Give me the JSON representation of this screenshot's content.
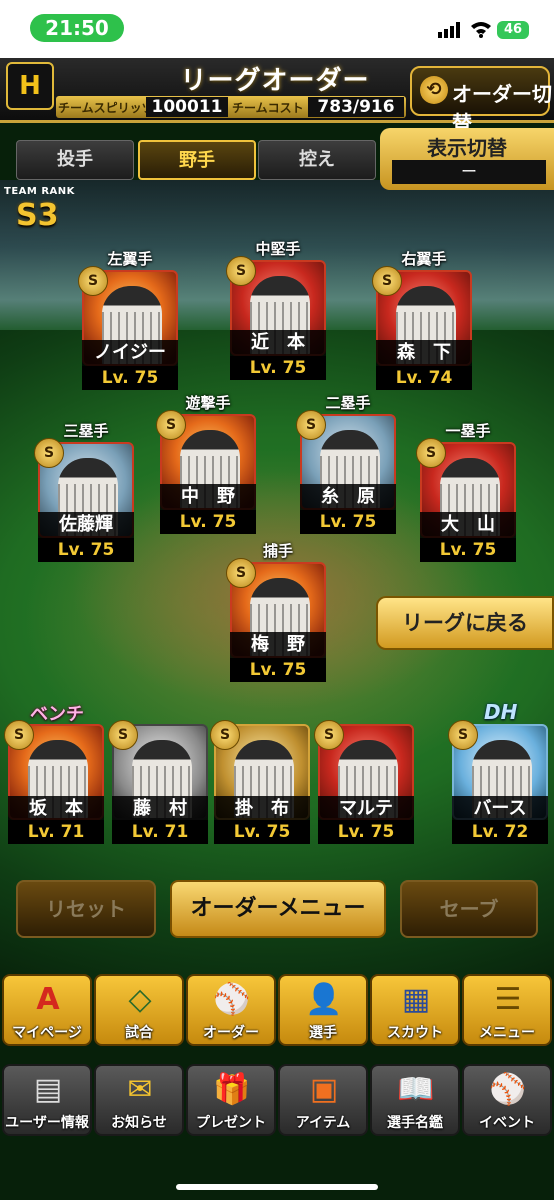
{
  "status_bar": {
    "time": "21:50",
    "battery": "46"
  },
  "header": {
    "logo": "H",
    "title": "リーグオーダー",
    "spirit_label": "チームスピリッツ",
    "spirit_value": "100011",
    "cost_label": "チームコスト",
    "cost_value": "783/916",
    "switch_button": "オーダー切替"
  },
  "tabs": [
    {
      "label": "投手",
      "active": false
    },
    {
      "label": "野手",
      "active": true
    },
    {
      "label": "控え",
      "active": false
    }
  ],
  "view_switch": {
    "label": "表示切替",
    "value": "ー"
  },
  "team_rank": {
    "label": "TEAM RANK",
    "value": "S3"
  },
  "players": [
    {
      "position": "左翼手",
      "name": "ノイジー",
      "level": "Lv. 75"
    },
    {
      "position": "中堅手",
      "name": "近　本",
      "level": "Lv. 75"
    },
    {
      "position": "右翼手",
      "name": "森　下",
      "level": "Lv. 74"
    },
    {
      "position": "遊撃手",
      "name": "中　野",
      "level": "Lv. 75"
    },
    {
      "position": "二塁手",
      "name": "糸　原",
      "level": "Lv. 75"
    },
    {
      "position": "三塁手",
      "name": "佐藤輝",
      "level": "Lv. 75"
    },
    {
      "position": "一塁手",
      "name": "大　山",
      "level": "Lv. 75"
    },
    {
      "position": "捕手",
      "name": "梅　野",
      "level": "Lv. 75"
    }
  ],
  "bench_label": "ベンチ",
  "dh_label": "DH",
  "bench": [
    {
      "name": "坂　本",
      "level": "Lv. 71"
    },
    {
      "name": "藤　村",
      "level": "Lv. 71"
    },
    {
      "name": "掛　布",
      "level": "Lv. 75"
    },
    {
      "name": "マルテ",
      "level": "Lv. 75"
    }
  ],
  "dh": {
    "name": "バース",
    "level": "Lv. 72"
  },
  "buttons": {
    "back_to_league": "リーグに戻る",
    "reset": "リセット",
    "order_menu": "オーダーメニュー",
    "save": "セーブ"
  },
  "nav_main": [
    {
      "label": "マイページ",
      "icon": "A"
    },
    {
      "label": "試合",
      "icon": "◇"
    },
    {
      "label": "オーダー",
      "icon": "⚾"
    },
    {
      "label": "選手",
      "icon": "👤"
    },
    {
      "label": "スカウト",
      "icon": "▦"
    },
    {
      "label": "メニュー",
      "icon": "☰"
    }
  ],
  "nav_sub": [
    {
      "label": "ユーザー情報",
      "icon": "▤"
    },
    {
      "label": "お知らせ",
      "icon": "✉"
    },
    {
      "label": "プレゼント",
      "icon": "🎁"
    },
    {
      "label": "アイテム",
      "icon": "▣"
    },
    {
      "label": "選手名鑑",
      "icon": "📖"
    },
    {
      "label": "イベント",
      "icon": "⚾"
    }
  ]
}
